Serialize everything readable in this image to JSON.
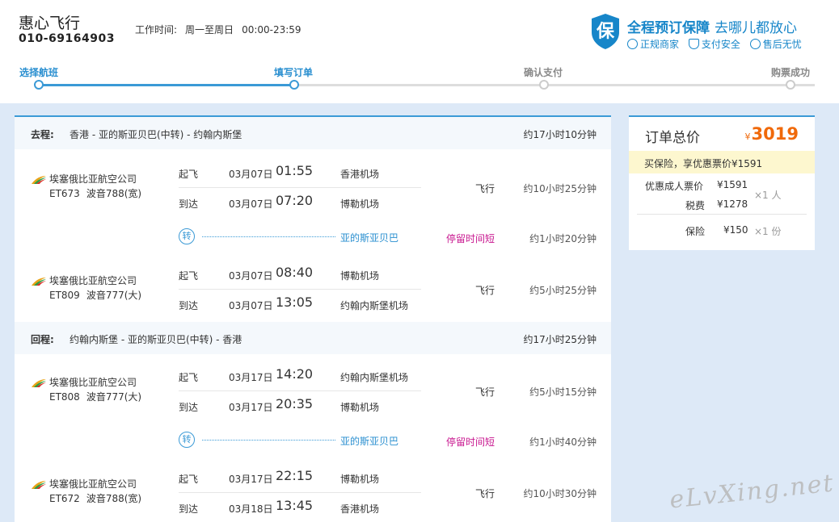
{
  "brand": {
    "name": "惠心飞行",
    "phone": "010-69164903"
  },
  "worktime": {
    "label": "工作时间:",
    "days": "周一至周日",
    "hours": "00:00-23:59"
  },
  "guarantee": {
    "title": "全程预订保障",
    "subtitle": "去哪儿都放心",
    "items": [
      "正规商家",
      "支付安全",
      "售后无忧"
    ],
    "badge": "保"
  },
  "steps": [
    "选择航班",
    "填写订单",
    "确认支付",
    "购票成功"
  ],
  "outbound": {
    "label": "去程:",
    "route": "香港 - 亚的斯亚贝巴(中转) - 约翰内斯堡",
    "total": "约17小时10分钟",
    "flights": [
      {
        "airline": "埃塞俄比亚航空公司",
        "number": "ET673",
        "aircraft": "波音788(宽)",
        "dep_label": "起飞",
        "dep_date": "03月07日",
        "dep_time": "01:55",
        "dep_airport": "香港机场",
        "arr_label": "到达",
        "arr_date": "03月07日",
        "arr_time": "07:20",
        "arr_airport": "博勒机场",
        "status": "飞行",
        "duration": "约10小时25分钟"
      },
      {
        "airline": "埃塞俄比亚航空公司",
        "number": "ET809",
        "aircraft": "波音777(大)",
        "dep_label": "起飞",
        "dep_date": "03月07日",
        "dep_time": "08:40",
        "dep_airport": "博勒机场",
        "arr_label": "到达",
        "arr_date": "03月07日",
        "arr_time": "13:05",
        "arr_airport": "约翰内斯堡机场",
        "status": "飞行",
        "duration": "约5小时25分钟"
      }
    ],
    "transfer": {
      "icon": "转",
      "city": "亚的斯亚贝巴",
      "warning": "停留时间短",
      "duration": "约1小时20分钟"
    }
  },
  "return": {
    "label": "回程:",
    "route": "约翰内斯堡 - 亚的斯亚贝巴(中转) - 香港",
    "total": "约17小时25分钟",
    "flights": [
      {
        "airline": "埃塞俄比亚航空公司",
        "number": "ET808",
        "aircraft": "波音777(大)",
        "dep_label": "起飞",
        "dep_date": "03月17日",
        "dep_time": "14:20",
        "dep_airport": "约翰内斯堡机场",
        "arr_label": "到达",
        "arr_date": "03月17日",
        "arr_time": "20:35",
        "arr_airport": "博勒机场",
        "status": "飞行",
        "duration": "约5小时15分钟"
      },
      {
        "airline": "埃塞俄比亚航空公司",
        "number": "ET672",
        "aircraft": "波音788(宽)",
        "dep_label": "起飞",
        "dep_date": "03月17日",
        "dep_time": "22:15",
        "dep_airport": "博勒机场",
        "arr_label": "到达",
        "arr_date": "03月18日",
        "arr_time": "13:45",
        "arr_airport": "香港机场",
        "status": "飞行",
        "duration": "约10小时30分钟"
      }
    ],
    "transfer": {
      "icon": "转",
      "city": "亚的斯亚贝巴",
      "warning": "停留时间短",
      "duration": "约1小时40分钟"
    }
  },
  "summary": {
    "title": "订单总价",
    "currency": "¥",
    "total": "3019",
    "promo": "买保险，享优惠票价¥1591",
    "fare_label": "优惠成人票价",
    "fare_value": "¥1591",
    "tax_label": "税费",
    "tax_value": "¥1278",
    "pax": "×1 人",
    "ins_label": "保险",
    "ins_value": "¥150",
    "ins_qty": "×1 份"
  },
  "watermark": "eLvXing.net",
  "colors": {
    "accent": "#3b9ad6",
    "price": "#f0690a",
    "warning": "#c8168f"
  }
}
